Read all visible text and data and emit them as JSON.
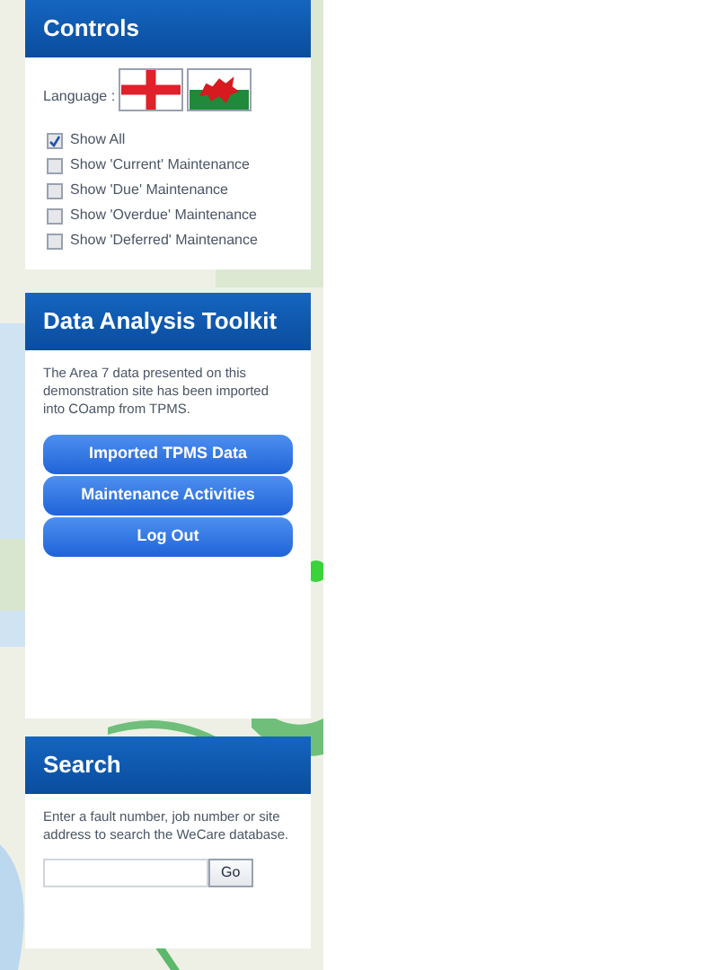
{
  "controls": {
    "title": "Controls",
    "language_label": "Language :",
    "languages": [
      {
        "kind": "england",
        "selected": false
      },
      {
        "kind": "wales",
        "selected": false
      }
    ],
    "filters": [
      {
        "label": "Show All",
        "checked": true
      },
      {
        "label": "Show 'Current' Maintenance",
        "checked": false
      },
      {
        "label": "Show 'Due' Maintenance",
        "checked": false
      },
      {
        "label": "Show 'Overdue' Maintenance",
        "checked": false
      },
      {
        "label": "Show 'Deferred' Maintenance",
        "checked": false
      }
    ]
  },
  "toolkit": {
    "title": "Data Analysis Toolkit",
    "text": "The Area 7 data presented on this demonstration site has been imported into COamp from TPMS.",
    "buttons": [
      "Imported TPMS Data",
      "Maintenance Activities",
      "Log Out"
    ]
  },
  "search": {
    "title": "Search",
    "text": "Enter a fault number, job number or site address to search the WeCare database.",
    "button": "Go"
  }
}
